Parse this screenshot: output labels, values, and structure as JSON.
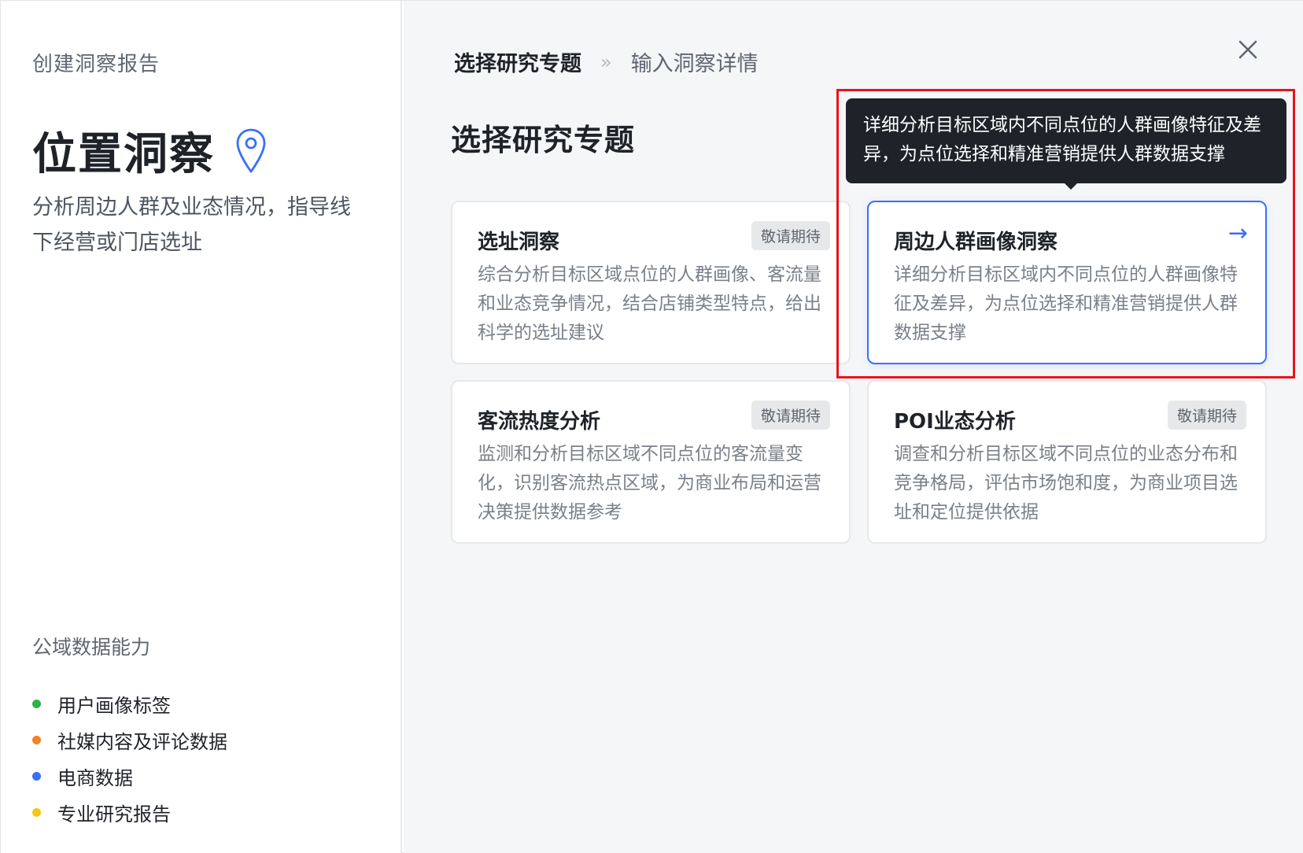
{
  "left": {
    "kicker": "创建洞察报告",
    "title": "位置洞察",
    "description": "分析周边人群及业态情况，指导线下经营或门店选址",
    "capabilities_title": "公域数据能力",
    "capabilities": [
      {
        "label": "用户画像标签",
        "color": "#2fb24a"
      },
      {
        "label": "社媒内容及评论数据",
        "color": "#f58220"
      },
      {
        "label": "电商数据",
        "color": "#3a6ff7"
      },
      {
        "label": "专业研究报告",
        "color": "#f5c518"
      }
    ]
  },
  "right": {
    "breadcrumb": {
      "step1": "选择研究专题",
      "separator": "»",
      "step2": "输入洞察详情"
    },
    "section_title": "选择研究专题",
    "tooltip": "详细分析目标区域内不同点位的人群画像特征及差异，为点位选择和精准营销提供人群数据支撑",
    "cards": [
      {
        "title": "选址洞察",
        "badge": "敬请期待",
        "description": "综合分析目标区域点位的人群画像、客流量和业态竞争情况，结合店铺类型特点，给出科学的选址建议"
      },
      {
        "title": "周边人群画像洞察",
        "arrow": "→",
        "description": "详细分析目标区域内不同点位的人群画像特征及差异，为点位选择和精准营销提供人群数据支撑"
      },
      {
        "title": "客流热度分析",
        "badge": "敬请期待",
        "description": "监测和分析目标区域不同点位的客流量变化，识别客流热点区域，为商业布局和运营决策提供数据参考"
      },
      {
        "title": "POI业态分析",
        "badge": "敬请期待",
        "description": "调查和分析目标区域不同点位的业态分布和竞争格局，评估市场饱和度，为商业项目选址和定位提供依据"
      }
    ],
    "accent_color": "#3a6ff7"
  }
}
